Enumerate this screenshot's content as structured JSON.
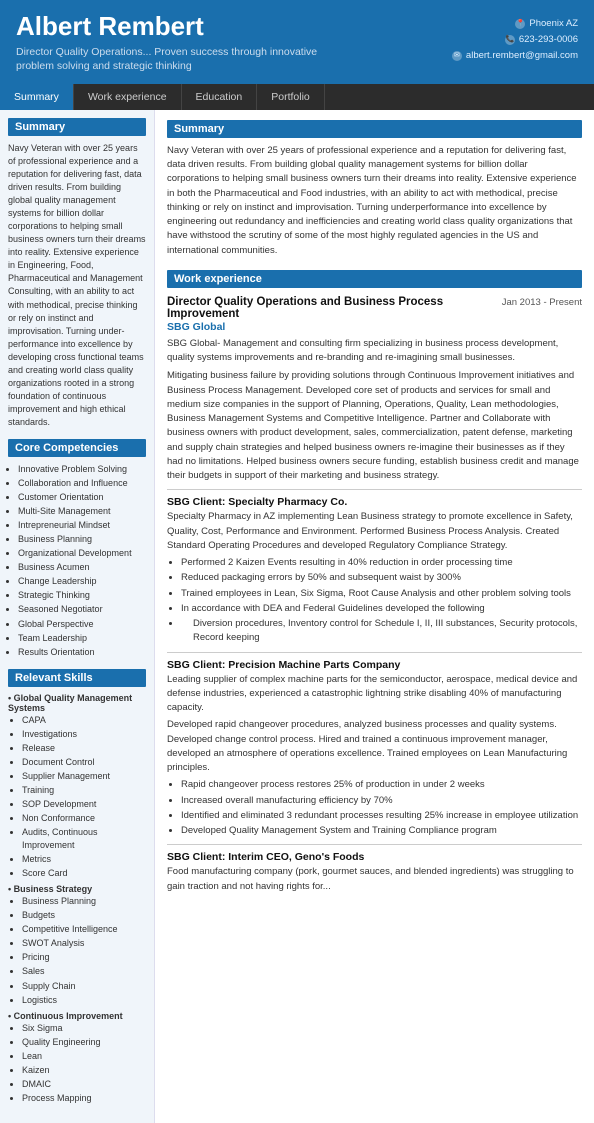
{
  "header": {
    "name": "Albert Rembert",
    "title": "Director Quality Operations... Proven success through innovative problem solving and strategic thinking",
    "contact": {
      "location": "Phoenix AZ",
      "phone": "623-293-0006",
      "email": "albert.rembert@gmail.com"
    }
  },
  "nav": {
    "items": [
      "Summary",
      "Work experience",
      "Education",
      "Portfolio"
    ],
    "active": "Summary"
  },
  "sidebar": {
    "summary_header": "Summary",
    "summary_text": "Navy Veteran with over 25 years of professional experience and a reputation for delivering fast, data driven results. From building global quality management systems for billion dollar corporations to helping small business owners turn their dreams into reality. Extensive experience in Engineering, Food, Pharmaceutical and Management Consulting, with an ability to act with methodical, precise thinking or rely on instinct and improvisation. Turning under-performance into excellence by developing cross functional teams and creating world class quality organizations rooted in a strong foundation of continuous improvement and high ethical standards.",
    "competencies_header": "Core Competencies",
    "competencies": [
      "Innovative Problem Solving",
      "Collaboration and Influence",
      "Customer Orientation",
      "Multi-Site Management",
      "Intrepreneurial Mindset",
      "Business Planning",
      "Organizational Development",
      "Business Acumen",
      "Change Leadership",
      "Strategic Thinking",
      "Seasoned Negotiator",
      "Global Perspective",
      "Team Leadership",
      "Results Orientation"
    ],
    "skills_header": "Relevant Skills",
    "skills": [
      {
        "category": "Global Quality Management Systems",
        "items": [
          "CAPA",
          "Investigations",
          "Release",
          "Document Control",
          "Supplier Management",
          "Training",
          "SOP Development",
          "Non Conformance",
          "Audits, Continuous Improvement",
          "Metrics",
          "Score Card"
        ]
      },
      {
        "category": "Business Strategy",
        "items": [
          "Business Planning",
          "Budgets",
          "Competitive Intelligence",
          "SWOT Analysis",
          "Pricing",
          "Sales",
          "Supply Chain",
          "Logistics"
        ]
      },
      {
        "category": "Continuous Improvement",
        "items": [
          "Six Sigma",
          "Quality Engineering",
          "Lean",
          "Kaizen",
          "DMAIC",
          "Process Mapping"
        ]
      }
    ]
  },
  "content": {
    "summary_header": "Summary",
    "summary_text": "Navy Veteran with over 25 years of professional experience and a reputation for delivering fast, data driven results. From building global quality management systems for billion dollar corporations to helping small business owners turn their dreams into reality. Extensive experience in both the Pharmaceutical and Food industries, with an ability to act with methodical, precise thinking or rely on instinct and improvisation. Turning underperformance into excellence by engineering out redundancy and inefficiencies and creating world class quality organizations that have withstood the scrutiny of some of the most highly regulated agencies in the US and international communities.",
    "work_header": "Work experience",
    "jobs": [
      {
        "title": "Director Quality Operations and  Business Process Improvement",
        "date": "Jan 2013 - Present",
        "company": "SBG Global",
        "description": "SBG Global- Management and consulting firm specializing in business process development, quality systems improvements and re-branding and re-imagining small businesses.",
        "desc2": "Mitigating business failure by providing solutions through Continuous Improvement initiatives and Business Process Management. Developed core set of products and services for small and medium size companies in the support of Planning, Operations, Quality, Lean methodologies, Business Management Systems and Competitive Intelligence. Partner and Collaborate with business owners with product development, sales, commercialization, patent defense, marketing and supply chain strategies and helped business owners re-imagine their businesses as if they had no limitations. Helped business owners secure funding, establish business credit and manage their budgets in support of their marketing and business strategy.",
        "sub_clients": [
          {
            "name": "SBG Client: Specialty Pharmacy Co.",
            "desc": "Specialty Pharmacy in AZ implementing Lean Business strategy to promote excellence in Safety, Quality, Cost, Performance and Environment. Performed Business Process Analysis. Created Standard Operating Procedures and developed Regulatory Compliance Strategy.",
            "bullets": [
              "Performed 2 Kaizen Events resulting in 40% reduction in order processing time",
              "Reduced packaging errors by 50% and subsequent waist by 300%",
              "Trained employees in Lean, Six Sigma, Root Cause Analysis and other problem solving tools",
              "In accordance with DEA and Federal Guidelines developed the following",
              "Diversion procedures, Inventory control for Schedule I, II, III substances, Security protocols, Record keeping"
            ],
            "sub_bullet_index": 4
          },
          {
            "name": "SBG Client: Precision Machine Parts Company",
            "desc": "Leading supplier of complex machine parts for the semiconductor, aerospace, medical device and defense industries, experienced a catastrophic lightning strike disabling 40% of manufacturing capacity.",
            "desc2": "Developed rapid changeover procedures, analyzed business processes and quality systems. Developed change control process. Hired and trained a continuous improvement manager, developed an atmosphere of operations excellence. Trained employees on Lean Manufacturing principles.",
            "bullets": [
              "Rapid changeover process restores 25% of production in under 2 weeks",
              "Increased overall manufacturing efficiency by 70%",
              "Identified and eliminated 3 redundant processes resulting 25% increase in employee utilization",
              "Developed Quality Management System and Training Compliance program"
            ]
          },
          {
            "name": "SBG Client: Interim CEO, Geno's Foods",
            "desc": "Food manufacturing company (pork, gourmet sauces, and blended ingredients) was struggling to gain traction and not having rights for..."
          }
        ]
      }
    ]
  }
}
